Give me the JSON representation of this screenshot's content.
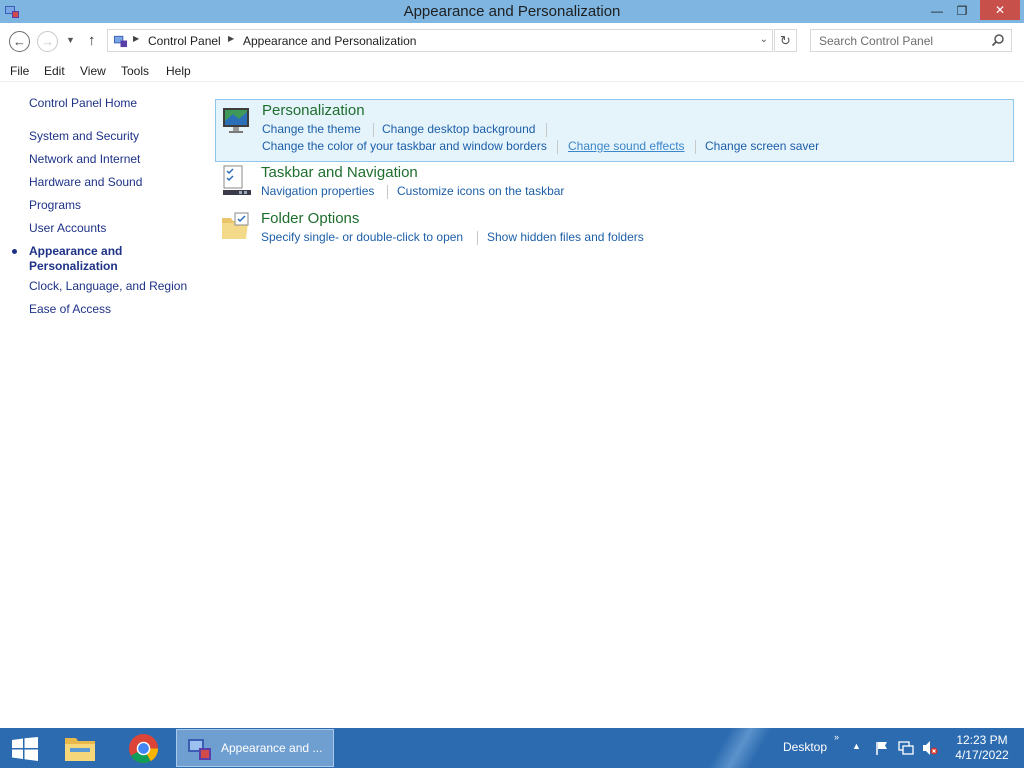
{
  "window": {
    "title": "Appearance and Personalization",
    "controls": {
      "minimize": "—",
      "maximize": "❐",
      "close": "✕"
    }
  },
  "address_bar": {
    "crumbs": [
      "Control Panel",
      "Appearance and Personalization"
    ],
    "search_placeholder": "Search Control Panel"
  },
  "menu": [
    "File",
    "Edit",
    "View",
    "Tools",
    "Help"
  ],
  "sidebar": {
    "home": "Control Panel Home",
    "items": [
      "System and Security",
      "Network and Internet",
      "Hardware and Sound",
      "Programs",
      "User Accounts",
      "Appearance and Personalization",
      "Clock, Language, and Region",
      "Ease of Access"
    ],
    "current_line1": "Appearance and",
    "current_line2": "Personalization"
  },
  "sections": {
    "personalization": {
      "title": "Personalization",
      "links": [
        "Change the theme",
        "Change desktop background",
        "Change the color of your taskbar and window borders",
        "Change sound effects",
        "Change screen saver"
      ]
    },
    "taskbar": {
      "title": "Taskbar and Navigation",
      "links": [
        "Navigation properties",
        "Customize icons on the taskbar"
      ]
    },
    "folder": {
      "title": "Folder Options",
      "links": [
        "Specify single- or double-click to open",
        "Show hidden files and folders"
      ]
    }
  },
  "taskbar": {
    "active_window": "Appearance and ...",
    "desktop_label": "Desktop",
    "time": "12:23 PM",
    "date": "4/17/2022"
  },
  "colors": {
    "titlebar": "#7eb6e1",
    "taskbar": "#2c6bb0",
    "link": "#1d5fa8",
    "heading": "#1e6e2e",
    "highlight": "#e5f3fb"
  }
}
